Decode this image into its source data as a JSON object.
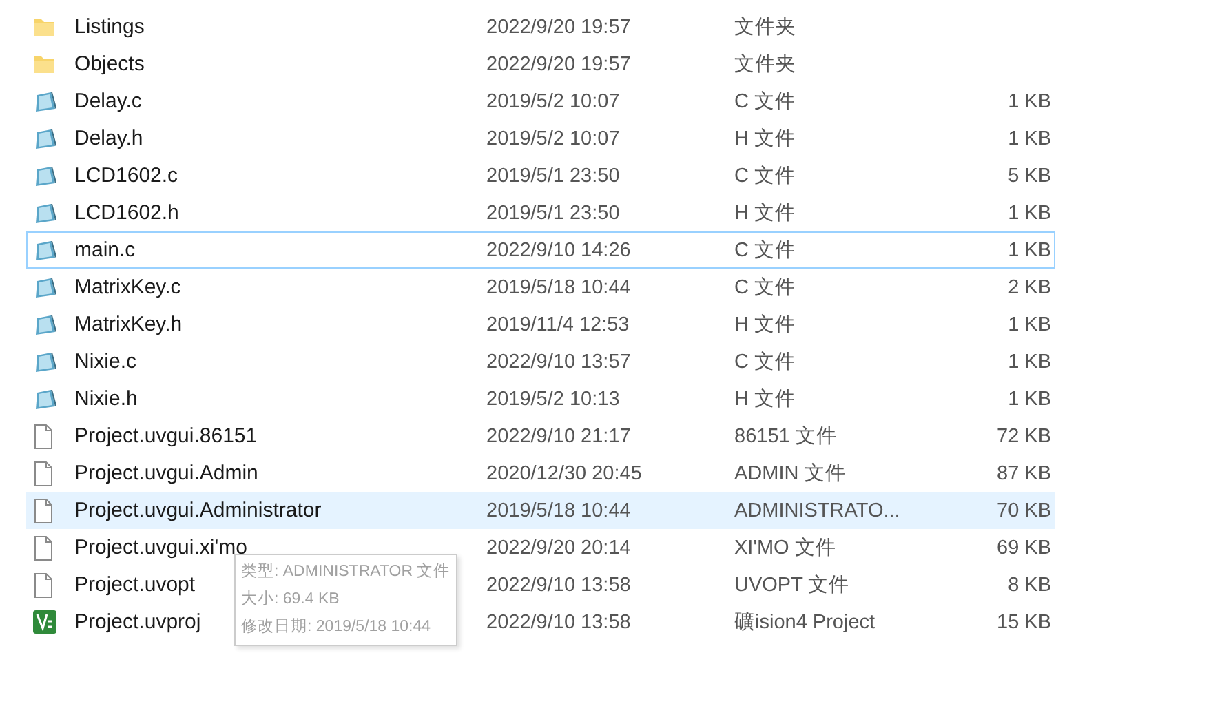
{
  "files": [
    {
      "name": "Listings",
      "modified": "2022/9/20 19:57",
      "type": "文件夹",
      "kind": "folder",
      "focused": false,
      "hovered": false
    },
    {
      "name": "Objects",
      "modified": "2022/9/20 19:57",
      "type": "文件夹",
      "kind": "folder",
      "focused": false,
      "hovered": false
    },
    {
      "name": "Delay.c",
      "modified": "2019/5/2 10:07",
      "type": "C 文件",
      "size": "1 KB",
      "kind": "source",
      "focused": false,
      "hovered": false
    },
    {
      "name": "Delay.h",
      "modified": "2019/5/2 10:07",
      "type": "H 文件",
      "size": "1 KB",
      "kind": "source",
      "focused": false,
      "hovered": false
    },
    {
      "name": "LCD1602.c",
      "modified": "2019/5/1 23:50",
      "type": "C 文件",
      "size": "5 KB",
      "kind": "source",
      "focused": false,
      "hovered": false
    },
    {
      "name": "LCD1602.h",
      "modified": "2019/5/1 23:50",
      "type": "H 文件",
      "size": "1 KB",
      "kind": "source",
      "focused": false,
      "hovered": false
    },
    {
      "name": "main.c",
      "modified": "2022/9/10 14:26",
      "type": "C 文件",
      "size": "1 KB",
      "kind": "source",
      "focused": true,
      "hovered": false
    },
    {
      "name": "MatrixKey.c",
      "modified": "2019/5/18 10:44",
      "type": "C 文件",
      "size": "2 KB",
      "kind": "source",
      "focused": false,
      "hovered": false
    },
    {
      "name": "MatrixKey.h",
      "modified": "2019/11/4 12:53",
      "type": "H 文件",
      "size": "1 KB",
      "kind": "source",
      "focused": false,
      "hovered": false
    },
    {
      "name": "Nixie.c",
      "modified": "2022/9/10 13:57",
      "type": "C 文件",
      "size": "1 KB",
      "kind": "source",
      "focused": false,
      "hovered": false
    },
    {
      "name": "Nixie.h",
      "modified": "2019/5/2 10:13",
      "type": "H 文件",
      "size": "1 KB",
      "kind": "source",
      "focused": false,
      "hovered": false
    },
    {
      "name": "Project.uvgui.86151",
      "modified": "2022/9/10 21:17",
      "type": "86151 文件",
      "size": "72 KB",
      "kind": "blank",
      "focused": false,
      "hovered": false
    },
    {
      "name": "Project.uvgui.Admin",
      "modified": "2020/12/30 20:45",
      "type": "ADMIN 文件",
      "size": "87 KB",
      "kind": "blank",
      "focused": false,
      "hovered": false
    },
    {
      "name": "Project.uvgui.Administrator",
      "modified": "2019/5/18 10:44",
      "type": "ADMINISTRATO...",
      "size": "70 KB",
      "kind": "blank",
      "focused": false,
      "hovered": true
    },
    {
      "name": "Project.uvgui.xi'mo",
      "modified": "2022/9/20 20:14",
      "type": "XI'MO 文件",
      "size": "69 KB",
      "kind": "blank",
      "focused": false,
      "hovered": false
    },
    {
      "name": "Project.uvopt",
      "modified": "2022/9/10 13:58",
      "type": "UVOPT 文件",
      "size": "8 KB",
      "kind": "blank",
      "focused": false,
      "hovered": false
    },
    {
      "name": "Project.uvproj",
      "modified": "2022/9/10 13:58",
      "type": "礦ision4 Project",
      "size": "15 KB",
      "kind": "project",
      "focused": false,
      "hovered": false
    }
  ],
  "tooltip": {
    "lines": [
      "类型: ADMINISTRATOR 文件",
      "大小: 69.4 KB",
      "修改日期: 2019/5/18 10:44"
    ]
  }
}
